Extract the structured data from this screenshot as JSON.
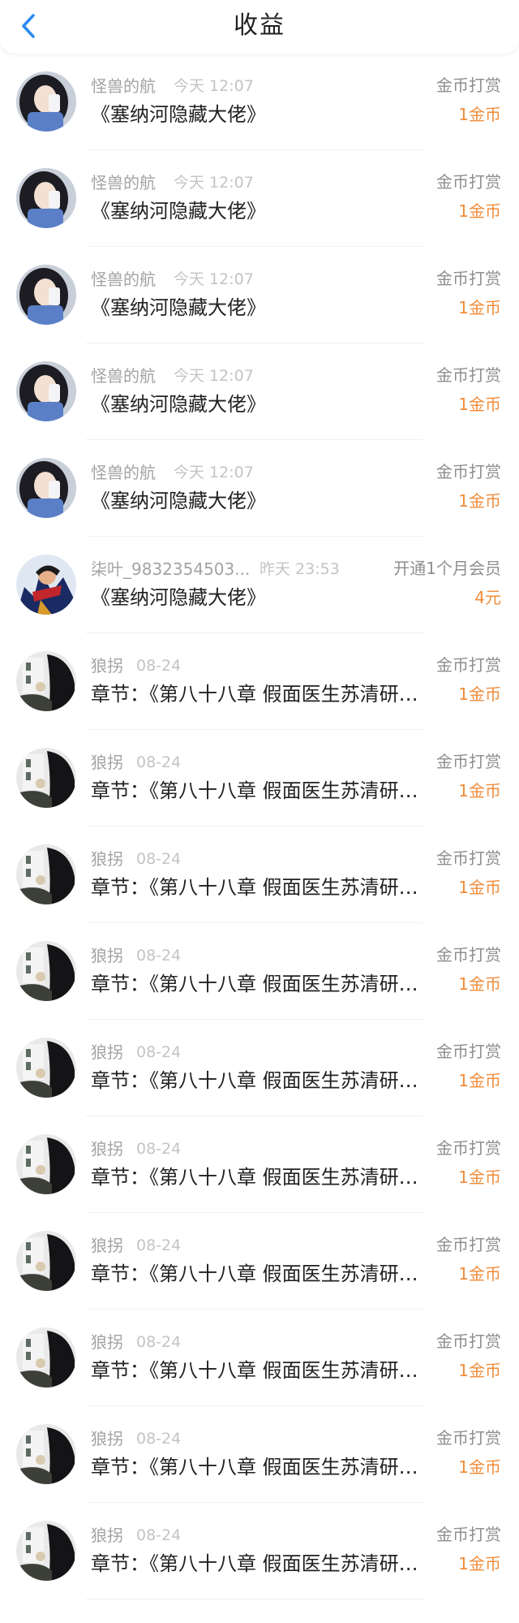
{
  "header": {
    "title": "收益",
    "back_icon": "chevron-left-icon"
  },
  "colors": {
    "accent_blue": "#2d8cf0",
    "amount_orange": "#f08c3a"
  },
  "records": [
    {
      "avatar": "avatar-girl",
      "name": "怪兽的航",
      "time": "今天 12:07",
      "type": "金币打赏",
      "title": "《塞纳河隐藏大佬》",
      "amount": "1金币"
    },
    {
      "avatar": "avatar-girl",
      "name": "怪兽的航",
      "time": "今天 12:07",
      "type": "金币打赏",
      "title": "《塞纳河隐藏大佬》",
      "amount": "1金币"
    },
    {
      "avatar": "avatar-girl",
      "name": "怪兽的航",
      "time": "今天 12:07",
      "type": "金币打赏",
      "title": "《塞纳河隐藏大佬》",
      "amount": "1金币"
    },
    {
      "avatar": "avatar-girl",
      "name": "怪兽的航",
      "time": "今天 12:07",
      "type": "金币打赏",
      "title": "《塞纳河隐藏大佬》",
      "amount": "1金币"
    },
    {
      "avatar": "avatar-girl",
      "name": "怪兽的航",
      "time": "今天 12:07",
      "type": "金币打赏",
      "title": "《塞纳河隐藏大佬》",
      "amount": "1金币"
    },
    {
      "avatar": "avatar-hero",
      "name": "柒叶_9832354503...",
      "time": "昨天 23:53",
      "type": "开通1个月会员",
      "title": "《塞纳河隐藏大佬》",
      "amount": "4元"
    },
    {
      "avatar": "avatar-street",
      "name": "狼拐",
      "time": "08-24",
      "type": "金币打赏",
      "title": "章节：《第八十八章  假面医生苏清研…",
      "amount": "1金币"
    },
    {
      "avatar": "avatar-street",
      "name": "狼拐",
      "time": "08-24",
      "type": "金币打赏",
      "title": "章节：《第八十八章  假面医生苏清研…",
      "amount": "1金币"
    },
    {
      "avatar": "avatar-street",
      "name": "狼拐",
      "time": "08-24",
      "type": "金币打赏",
      "title": "章节：《第八十八章  假面医生苏清研…",
      "amount": "1金币"
    },
    {
      "avatar": "avatar-street",
      "name": "狼拐",
      "time": "08-24",
      "type": "金币打赏",
      "title": "章节：《第八十八章  假面医生苏清研…",
      "amount": "1金币"
    },
    {
      "avatar": "avatar-street",
      "name": "狼拐",
      "time": "08-24",
      "type": "金币打赏",
      "title": "章节：《第八十八章  假面医生苏清研…",
      "amount": "1金币"
    },
    {
      "avatar": "avatar-street",
      "name": "狼拐",
      "time": "08-24",
      "type": "金币打赏",
      "title": "章节：《第八十八章  假面医生苏清研…",
      "amount": "1金币"
    },
    {
      "avatar": "avatar-street",
      "name": "狼拐",
      "time": "08-24",
      "type": "金币打赏",
      "title": "章节：《第八十八章  假面医生苏清研…",
      "amount": "1金币"
    },
    {
      "avatar": "avatar-street",
      "name": "狼拐",
      "time": "08-24",
      "type": "金币打赏",
      "title": "章节：《第八十八章  假面医生苏清研…",
      "amount": "1金币"
    },
    {
      "avatar": "avatar-street",
      "name": "狼拐",
      "time": "08-24",
      "type": "金币打赏",
      "title": "章节：《第八十八章  假面医生苏清研…",
      "amount": "1金币"
    },
    {
      "avatar": "avatar-street",
      "name": "狼拐",
      "time": "08-24",
      "type": "金币打赏",
      "title": "章节：《第八十八章  假面医生苏清研…",
      "amount": "1金币"
    }
  ]
}
